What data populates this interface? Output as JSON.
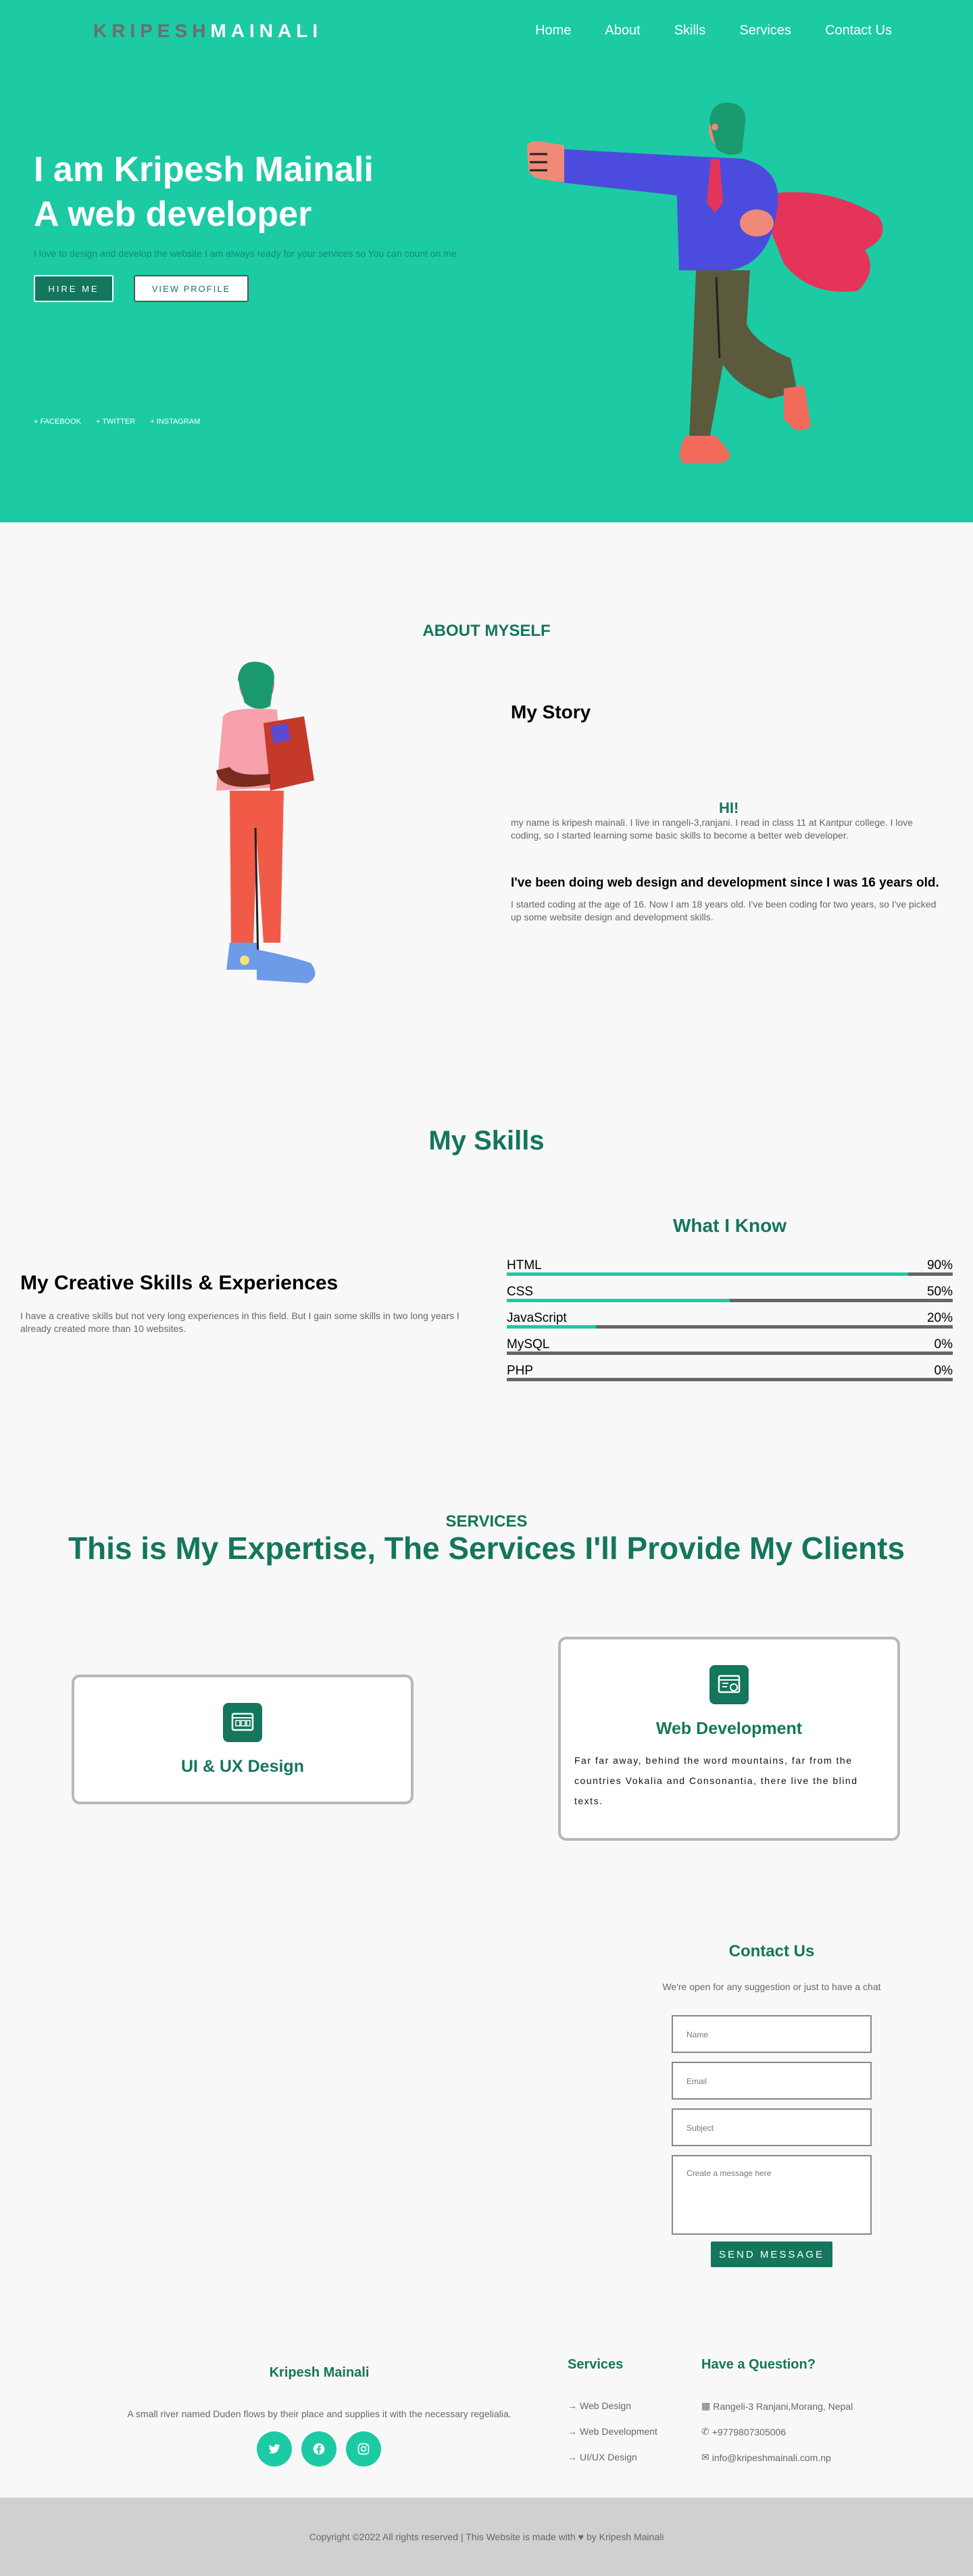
{
  "brand": {
    "first": "KRIPESH",
    "last": "MAINALI"
  },
  "nav": {
    "home": "Home",
    "about": "About",
    "skills": "Skills",
    "services": "Services",
    "contact": "Contact Us"
  },
  "hero": {
    "title_line1": "I am Kripesh Mainali",
    "title_line2": "A web developer",
    "subtitle": "I love to design and develop the website I am always ready for your services so You can count on me.",
    "hire_label": "HIRE ME",
    "view_label": "VIEW PROFILE",
    "socials": [
      "+ FACEBOOK",
      "+ TWITTER",
      "+ INSTAGRAM"
    ],
    "accent_color": "#1ccaa4"
  },
  "about": {
    "heading": "ABOUT MYSELF",
    "story_title": "My Story",
    "hi": "HI!",
    "story_text": "my name is kripesh mainali. I live in rangeli-3,ranjani. I read in class 11 at Kantpur college. I love coding, so I started learning some basic skills to become a better web developer.",
    "story_sub": "I've been doing web design and development since I was 16 years old.",
    "story_text2": "I started coding at the age of 16. Now I am 18 years old. I've been coding for two years, so I've picked up some website design and development skills."
  },
  "skills": {
    "heading": "My Skills",
    "know_heading": "What I Know",
    "creative_title": "My Creative Skills & Experiences",
    "creative_text": "I have a creative skills but not very long experiences in this field. But I gain some skills in two long years I already created more than 10 websites.",
    "items": [
      {
        "name": "HTML",
        "percent_label": "90%",
        "value": 90
      },
      {
        "name": "CSS",
        "percent_label": "50%",
        "value": 50
      },
      {
        "name": "JavaScript",
        "percent_label": "20%",
        "value": 20
      },
      {
        "name": "MySQL",
        "percent_label": "0%",
        "value": 0
      },
      {
        "name": "PHP",
        "percent_label": "0%",
        "value": 0
      }
    ]
  },
  "services": {
    "label": "SERVICES",
    "title": "This is My Expertise, The Services I'll Provide My Clients",
    "cards": [
      {
        "title": "UI & UX Design",
        "icon": "design-icon"
      },
      {
        "title": "Web Development",
        "icon": "web-dev-icon",
        "desc": "Far far away, behind the word mountains, far from the countries Vokalia and Consonantia, there live the blind texts."
      }
    ]
  },
  "contact": {
    "title": "Contact Us",
    "subtitle": "We're open for any suggestion or just to have a chat",
    "name_placeholder": "Name",
    "email_placeholder": "Email",
    "subject_placeholder": "Subject",
    "message_placeholder": "Create a message here",
    "send_label": "SEND MESSAGE"
  },
  "footer": {
    "name": "Kripesh Mainali",
    "desc": "A small river named Duden flows by their place and supplies it with the necessary regelialia.",
    "services_title": "Services",
    "services": [
      "Web Design",
      "Web Development",
      "UI/UX Design"
    ],
    "question_title": "Have a Question?",
    "address": "Rangeli-3 Ranjani,Morang, Nepal",
    "phone": "+9779807305006",
    "email": "info@kripeshmainali.com.np",
    "copyright_pre": "Copyright ©2022 All rights reserved | This Website is made with",
    "copyright_post": "by Kripesh Mainali"
  }
}
